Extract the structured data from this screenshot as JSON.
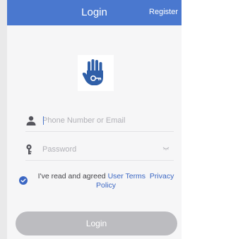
{
  "header": {
    "title": "Login",
    "register_label": "Register"
  },
  "form": {
    "account_placeholder": "Phone Number or Email",
    "account_value": "",
    "password_placeholder": "Password",
    "password_value": ""
  },
  "agreement": {
    "checked": true,
    "prefix": "I've read and agreed ",
    "user_terms": "User Terms",
    "privacy_policy": "Privacy Policy"
  },
  "login_button": {
    "label": "Login",
    "enabled": false
  },
  "colors": {
    "header": "#4a78cf",
    "link": "#3a66c3",
    "button_disabled": "#bcbcc0",
    "background": "#f6f6f7"
  },
  "icons": {
    "logo": "hand-key-icon",
    "account": "person-icon",
    "password": "key-icon",
    "visibility": "eye-closed-icon",
    "agreement": "check-circle-icon"
  }
}
